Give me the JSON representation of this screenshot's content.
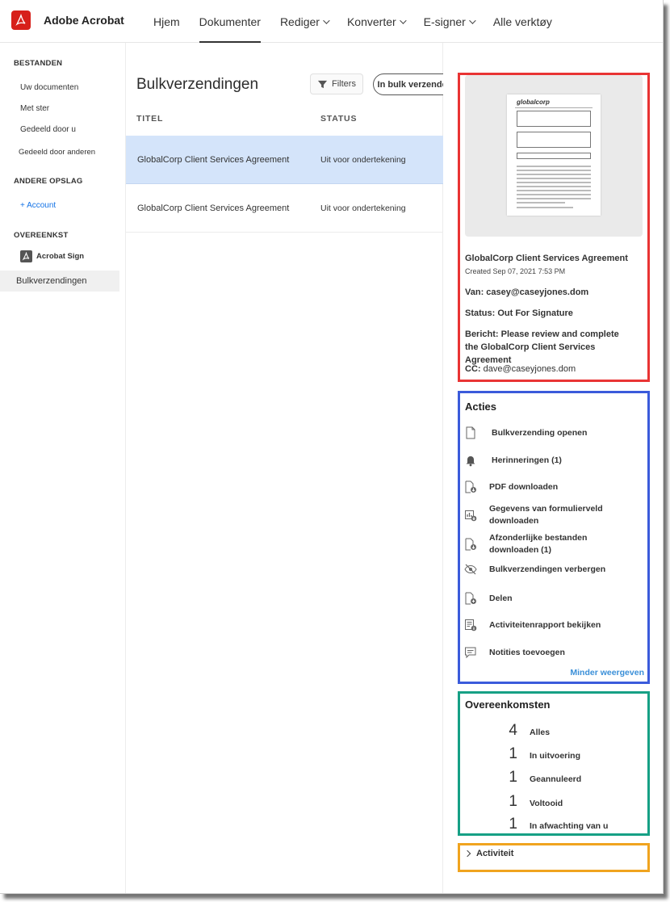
{
  "app": {
    "title": "Adobe Acrobat"
  },
  "nav": [
    {
      "label": "Hjem",
      "dropdown": false,
      "active": false
    },
    {
      "label": "Dokumenter",
      "dropdown": false,
      "active": true
    },
    {
      "label": "Rediger",
      "dropdown": true,
      "active": false
    },
    {
      "label": "Konverter",
      "dropdown": true,
      "active": false
    },
    {
      "label": "E-signer",
      "dropdown": true,
      "active": false
    },
    {
      "label": "Alle verktøy",
      "dropdown": false,
      "active": false
    }
  ],
  "sidebar": {
    "files_header": "BESTANDEN",
    "files_items": [
      "Uw documenten",
      "Met ster",
      "Gedeeld door u",
      "Gedeeld door anderen"
    ],
    "storage_header": "ANDERE OPSLAG",
    "add_account": "+ Account",
    "agreement_header": "OVEREENKST",
    "acrobat_sign": "Acrobat Sign",
    "selected_item": "Bulkverzendingen"
  },
  "main": {
    "title": "Bulkverzendingen",
    "filters_label": "Filters",
    "bulk_send_label": "In bulk verzenden",
    "col_title": "TITEL",
    "col_status": "STATUS",
    "rows": [
      {
        "title": "GlobalCorp Client Services Agreement",
        "status": "Uit voor ondertekening",
        "selected": true
      },
      {
        "title": "GlobalCorp Client Services Agreement",
        "status": "Uit voor ondertekening",
        "selected": false
      }
    ]
  },
  "details": {
    "thumbnail_logo": "globalcorp",
    "title": "GlobalCorp Client Services Agreement",
    "created": "Created Sep 07, 2021 7:53 PM",
    "from_label": "Van:",
    "from_value": "casey@caseyjones.dom",
    "status_label": "Status:",
    "status_value": "Out For Signature",
    "message_label": "Bericht:",
    "message_value": "Please review and complete the GlobalCorp Client Services Agreement",
    "cc_label": "CC:",
    "cc_value": "dave@caseyjones.dom"
  },
  "actions": {
    "title": "Acties",
    "items": [
      {
        "label": "Bulkverzending openen",
        "icon": "document-icon"
      },
      {
        "label": "Herinneringen (1)",
        "icon": "bell-icon"
      },
      {
        "label": "PDF downloaden",
        "icon": "pdf-download-icon"
      },
      {
        "label": "Gegevens van formulierveld downloaden",
        "icon": "chart-download-icon"
      },
      {
        "label": "Afzonderlijke bestanden downloaden (1)",
        "icon": "file-download-icon"
      },
      {
        "label": "Bulkverzendingen verbergen",
        "icon": "eye-hidden-icon"
      },
      {
        "label": "Delen",
        "icon": "share-file-icon"
      },
      {
        "label": "Activiteitenrapport bekijken",
        "icon": "report-info-icon"
      },
      {
        "label": "Notities toevoegen",
        "icon": "comment-icon"
      }
    ],
    "show_less": "Minder weergeven"
  },
  "agreements": {
    "title": "Overeenkomsten",
    "stats": [
      {
        "count": "4",
        "label": "Alles"
      },
      {
        "count": "1",
        "label": "In uitvoering"
      },
      {
        "count": "1",
        "label": "Geannuleerd"
      },
      {
        "count": "1",
        "label": "Voltooid"
      },
      {
        "count": "1",
        "label": "In afwachting van u"
      }
    ]
  },
  "activity": {
    "label": "Activiteit"
  },
  "colors": {
    "brand": "#d7201a",
    "selected_row": "#d4e4fa",
    "link": "#1473e6",
    "box_red": "#e93434",
    "box_blue": "#3b5bdb",
    "box_green": "#16a085",
    "box_orange": "#f0a41f"
  }
}
